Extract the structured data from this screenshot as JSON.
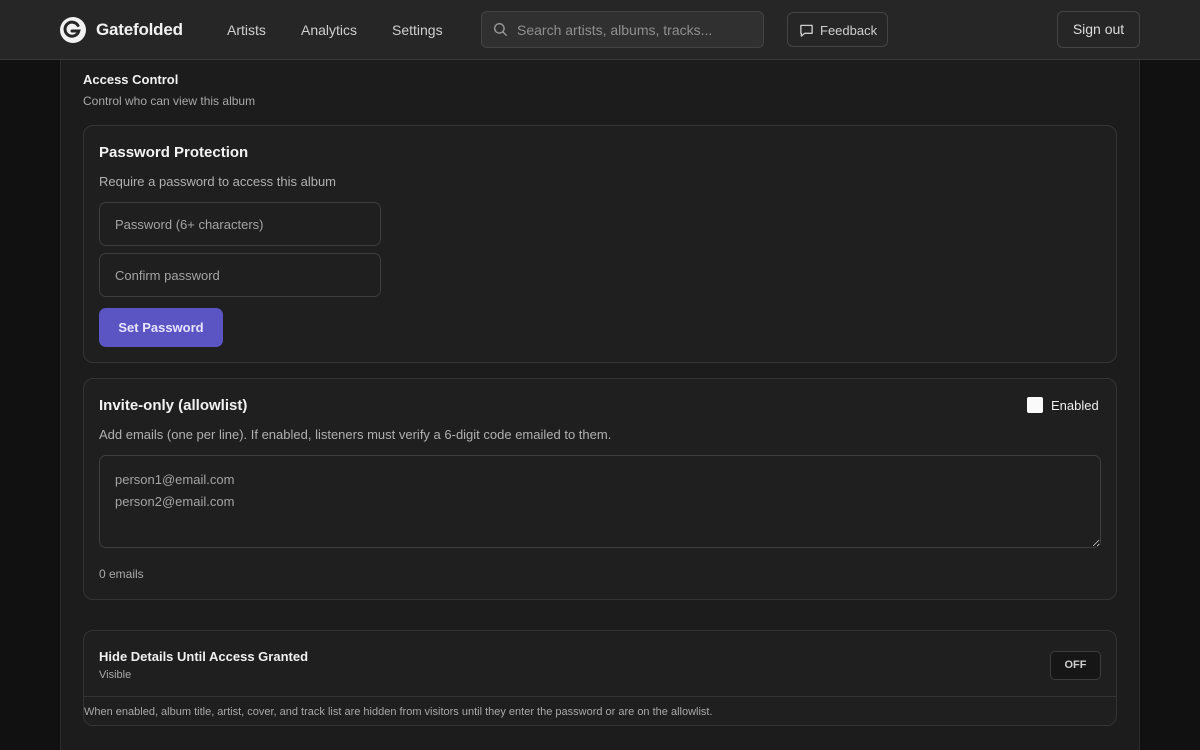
{
  "app": {
    "brand": "Gatefolded",
    "nav": [
      "Artists",
      "Analytics",
      "Settings"
    ],
    "search_placeholder": "Search artists, albums, tracks...",
    "feedback_label": "Feedback",
    "signout_label": "Sign out"
  },
  "access_control": {
    "title": "Access Control",
    "subtitle": "Control who can view this album"
  },
  "password": {
    "title": "Password Protection",
    "description": "Require a password to access this album",
    "password_placeholder": "Password (6+ characters)",
    "confirm_placeholder": "Confirm password",
    "button_label": "Set Password"
  },
  "invite": {
    "title": "Invite-only (allowlist)",
    "enabled_label": "Enabled",
    "enabled": false,
    "description": "Add emails (one per line). If enabled, listeners must verify a 6-digit code emailed to them.",
    "emails_placeholder": "person1@email.com\nperson2@email.com",
    "count_text": "0 emails"
  },
  "hide_details": {
    "title": "Hide Details Until Access Granted",
    "status": "Visible",
    "toggle_label": "OFF",
    "note": "When enabled, album title, artist, cover, and track list are hidden from visitors until they enter the password or are on the allowlist."
  },
  "colors": {
    "accent": "#5b55c4",
    "background": "#111111",
    "surface": "#1f1f1f"
  }
}
